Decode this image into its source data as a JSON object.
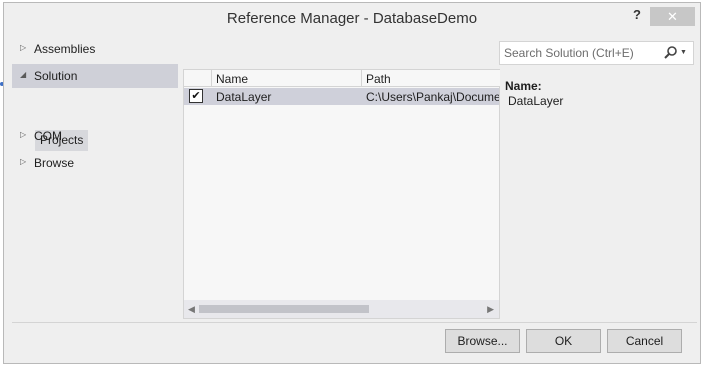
{
  "window": {
    "title": "Reference Manager - DatabaseDemo",
    "help_label": "?",
    "close_label": "✕"
  },
  "sidebar": {
    "items": [
      {
        "label": "Assemblies",
        "arrow": "▷",
        "selected": false
      },
      {
        "label": "Solution",
        "arrow": "◢",
        "selected": true
      },
      {
        "label": "COM",
        "arrow": "▷",
        "selected": false
      },
      {
        "label": "Browse",
        "arrow": "▷",
        "selected": false
      }
    ],
    "sub_item": {
      "label": "Projects"
    }
  },
  "list": {
    "columns": [
      "Name",
      "Path"
    ],
    "rows": [
      {
        "checked": true,
        "check_glyph": "✔",
        "name": "DataLayer",
        "path": "C:\\Users\\Pankaj\\Docume"
      }
    ],
    "scroll": {
      "left_arrow": "◀",
      "right_arrow": "▶"
    }
  },
  "search": {
    "placeholder": "Search Solution (Ctrl+E)",
    "icon": "search-icon",
    "dropdown_glyph": "▼"
  },
  "details": {
    "name_label": "Name:",
    "name_value": "DataLayer"
  },
  "footer": {
    "browse_label": "Browse...",
    "ok_label": "OK",
    "cancel_label": "Cancel"
  },
  "colors": {
    "window_bg": "#efefef",
    "selection": "#cfd0da",
    "close_button": "#c7c7c7"
  }
}
